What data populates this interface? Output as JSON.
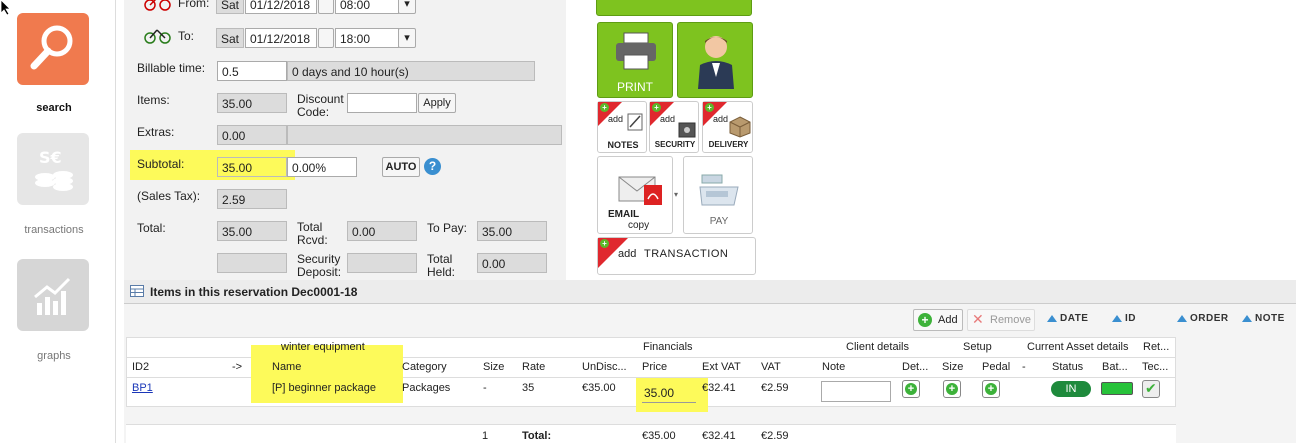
{
  "sidebar": {
    "items": [
      {
        "label": "search",
        "icon": "magnifier-icon",
        "color": "#f07a4e"
      },
      {
        "label": "transactions",
        "icon": "coins-icon",
        "color": "#e6e6e6"
      },
      {
        "label": "graphs",
        "icon": "chart-icon",
        "color": "#d6d6d6"
      }
    ]
  },
  "form": {
    "from_label": "From:",
    "from_day": "Sat",
    "from_date": "01/12/2018",
    "from_time": "08:00",
    "to_label": "To:",
    "to_day": "Sat",
    "to_date": "01/12/2018",
    "to_time": "18:00",
    "billable_label": "Billable time:",
    "billable_value": "0.5",
    "billable_desc": "0 days and 10 hour(s)",
    "items_label": "Items:",
    "items_value": "35.00",
    "discount_label": "Discount Code:",
    "discount_value": "",
    "apply_label": "Apply",
    "extras_label": "Extras:",
    "extras_value": "0.00",
    "subtotal_label": "Subtotal:",
    "subtotal_value": "35.00",
    "subtotal_percent": "0.00%",
    "auto_label": "AUTO",
    "help_label": "?",
    "tax_label": "(Sales Tax):",
    "tax_value": "2.59",
    "total_label": "Total:",
    "total_value": "35.00",
    "total_rcvd_label": "Total Rcvd:",
    "total_rcvd_value": "0.00",
    "topay_label": "To Pay:",
    "topay_value": "35.00",
    "deposit_label": "Security Deposit:",
    "deposit_value": "",
    "held_label": "Total Held:",
    "held_value": "0.00"
  },
  "tiles": {
    "print_label": "PRINT",
    "add_label": "add",
    "notes_label": "NOTES",
    "security_label": "SECURITY",
    "delivery_label": "DELIVERY",
    "email_label": "EMAIL",
    "copy_label": "copy",
    "pay_label": "PAY",
    "transaction_label": "TRANSACTION",
    "accent_green": "#7ec31f",
    "accent_red": "#e0282e"
  },
  "items_panel": {
    "title": "Items in this reservation Dec0001-18",
    "toolbar": {
      "add_label": "Add",
      "remove_label": "Remove",
      "sort_date": "DATE",
      "sort_id": "ID",
      "sort_order": "ORDER",
      "sort_note": "NOTE"
    },
    "groups": {
      "winter": "winter equipment",
      "financials": "Financials",
      "client": "Client details",
      "setup": "Setup",
      "asset": "Current Asset details",
      "ret": "Ret..."
    },
    "columns": [
      "ID2",
      "->",
      "Name",
      "Category",
      "Size",
      "Rate",
      "UnDisc...",
      "Price",
      "Ext VAT",
      "VAT",
      "Note",
      "Det...",
      "Size",
      "Pedal",
      "-",
      "Status",
      "Bat...",
      "Tec..."
    ],
    "row": {
      "id2": "BP1",
      "name": "[P] beginner package",
      "category": "Packages",
      "size": "-",
      "rate": "35",
      "undisc": "€35.00",
      "price": "35.00",
      "ext_vat": "€32.41",
      "vat": "€2.59",
      "note": "",
      "status": "IN"
    },
    "totals": {
      "count": "1",
      "label": "Total:",
      "price": "€35.00",
      "ext_vat": "€32.41",
      "vat": "€2.59"
    }
  },
  "colors": {
    "highlight": "#fdfa5a",
    "status_green": "#1e8a3c",
    "battery_green": "#27c23a"
  }
}
